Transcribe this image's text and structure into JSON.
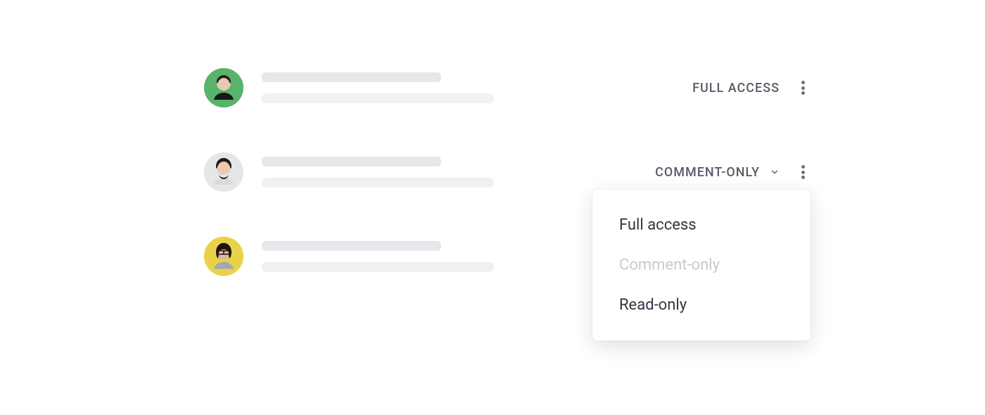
{
  "rows": [
    {
      "avatar_bg": "#58b36b",
      "permission_label": "FULL ACCESS",
      "has_chevron": false
    },
    {
      "avatar_bg": "#e5e6e8",
      "permission_label": "COMMENT-ONLY",
      "has_chevron": true
    },
    {
      "avatar_bg": "#e9d24a",
      "permission_label": "",
      "has_chevron": false
    }
  ],
  "dropdown": {
    "options": [
      {
        "label": "Full access",
        "state": "normal"
      },
      {
        "label": "Comment-only",
        "state": "disabled"
      },
      {
        "label": "Read-only",
        "state": "normal"
      }
    ]
  }
}
